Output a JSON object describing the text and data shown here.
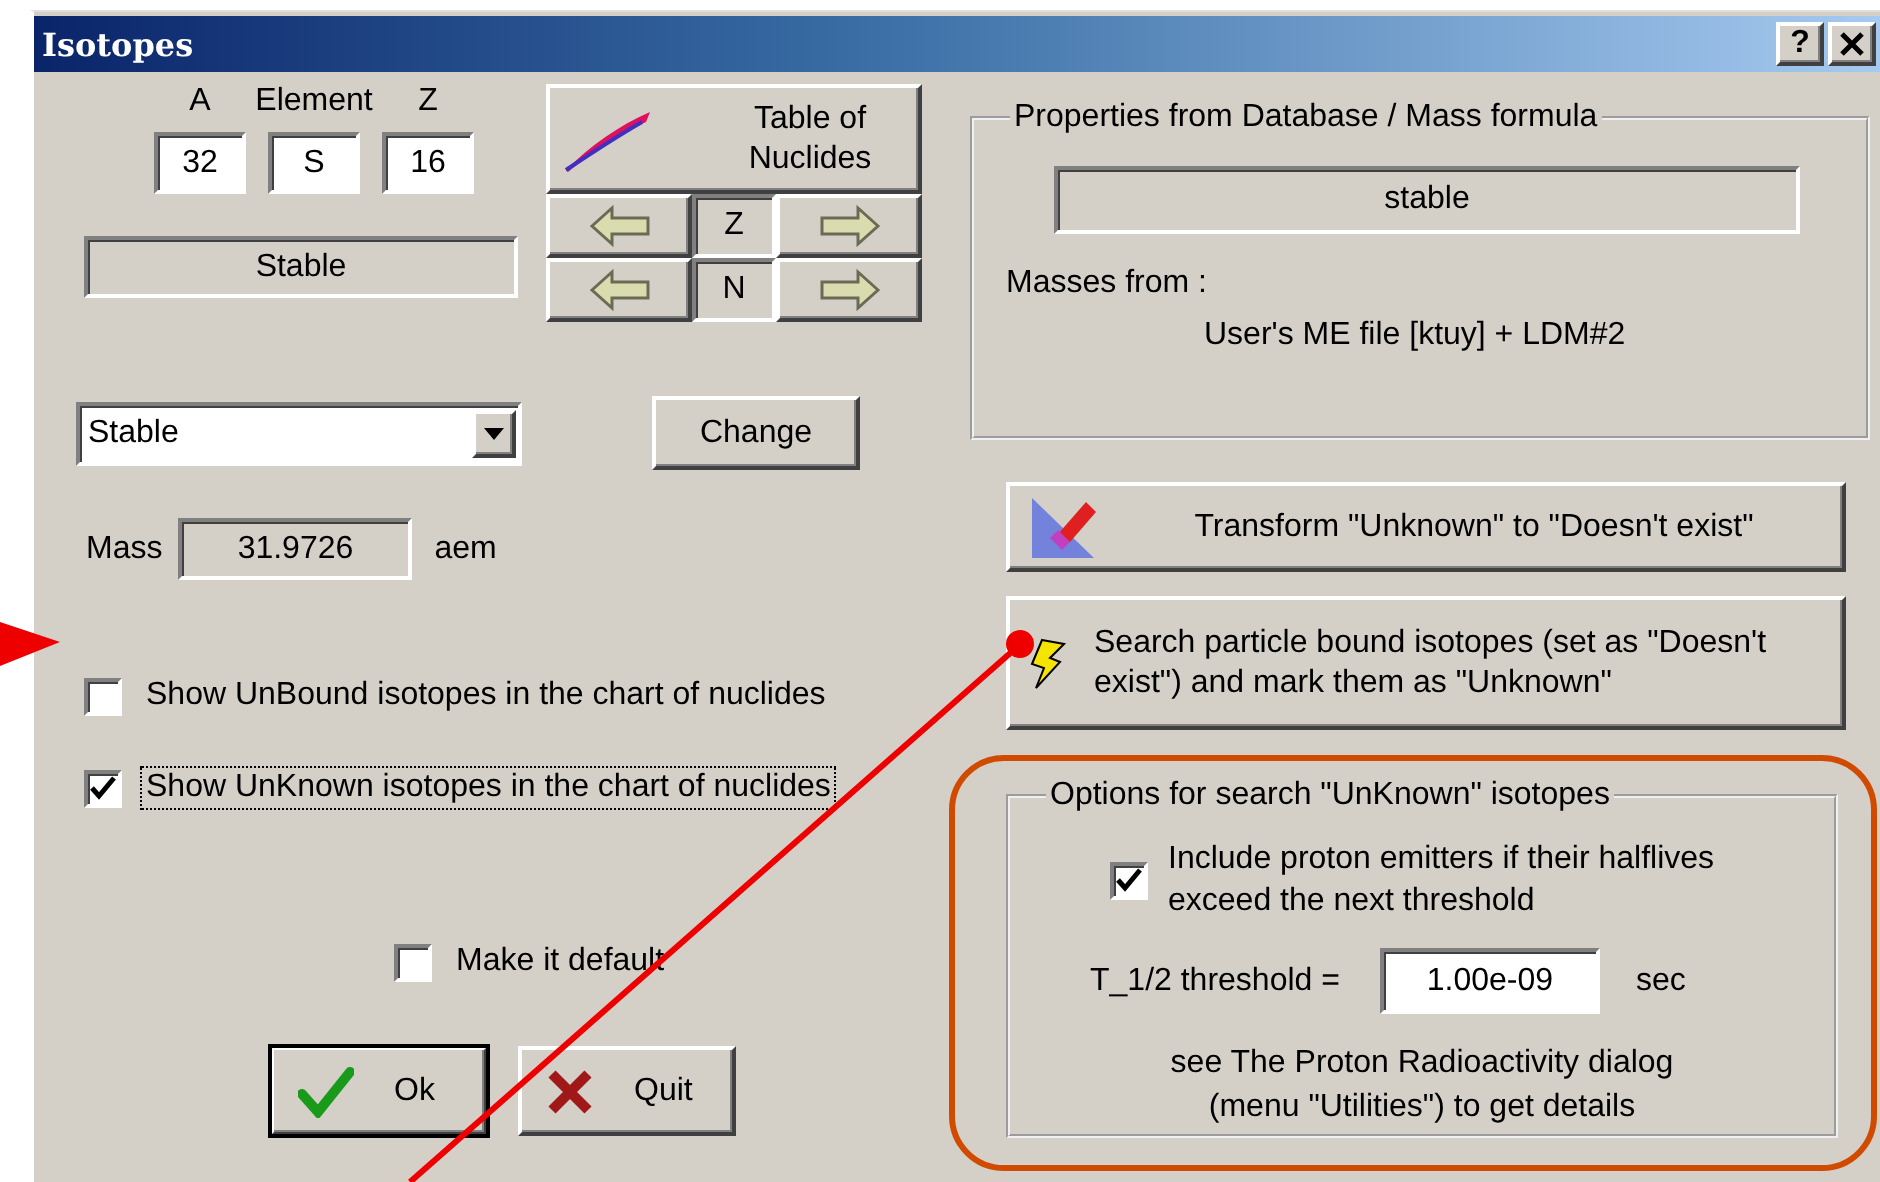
{
  "window": {
    "title": "Isotopes",
    "help": "?"
  },
  "nuclide_fields": [
    {
      "label": "A",
      "value": "32"
    },
    {
      "label": "Element",
      "value": "S"
    },
    {
      "label": "Z",
      "value": "16"
    }
  ],
  "status": "Stable",
  "table_button": {
    "label": "Table of Nuclides"
  },
  "navigation": [
    {
      "axis": "Z"
    },
    {
      "axis": "N"
    }
  ],
  "decay_select": {
    "value": "Stable"
  },
  "change_button": "Change",
  "mass": {
    "label": "Mass",
    "value": "31.9726",
    "unit": "aem"
  },
  "checkboxes": [
    {
      "label": "Show UnBound isotopes in the chart of nuclides",
      "checked": false,
      "focused": false
    },
    {
      "label": "Show UnKnown isotopes in the chart of nuclides",
      "checked": true,
      "focused": true
    }
  ],
  "make_default": {
    "label": "Make it default",
    "checked": false
  },
  "buttons": [
    {
      "kind": "ok",
      "label": "Ok",
      "default": true
    },
    {
      "kind": "quit",
      "label": "Quit",
      "default": false
    }
  ],
  "properties": {
    "title": "Properties from Database / Mass formula",
    "status": "stable",
    "masses_label": "Masses from :",
    "masses_source": "User's ME file [ktuy] + LDM#2"
  },
  "actions": [
    {
      "kind": "transform",
      "label": "Transform \"Unknown\" to \"Doesn't exist\""
    },
    {
      "kind": "search",
      "label": "Search particle bound isotopes (set as \"Doesn't exist\") and mark them as \"Unknown\""
    }
  ],
  "options": {
    "title": "Options for search \"UnKnown\" isotopes",
    "include": {
      "label": "Include proton emitters if their halflives exceed the next threshold",
      "checked": true
    },
    "threshold": {
      "label": "T_1/2 threshold =",
      "value": "1.00e-09",
      "unit": "sec"
    },
    "note_lines": [
      "see The Proton Radioactivity dialog",
      "(menu \"Utilities\")  to get details"
    ]
  }
}
